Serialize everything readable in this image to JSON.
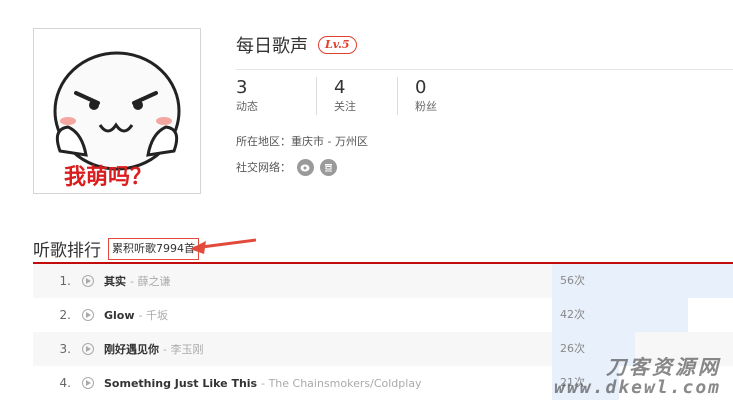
{
  "profile": {
    "name": "每日歌声",
    "level": "Lv.5",
    "stats": [
      {
        "value": "3",
        "label": "动态"
      },
      {
        "value": "4",
        "label": "关注"
      },
      {
        "value": "0",
        "label": "粉丝"
      }
    ],
    "location_label": "所在地区：",
    "location_value": "重庆市 - 万州区",
    "social_label": "社交网络：",
    "avatar_caption": "我萌吗？"
  },
  "ranking": {
    "title": "听歌排行",
    "total": "累积听歌7994首",
    "rows": [
      {
        "rank": "1.",
        "song": "其实",
        "artist": "- 薛之谦",
        "count": "56次",
        "fill": 1.0
      },
      {
        "rank": "2.",
        "song": "Glow",
        "artist": "- 千坂",
        "count": "42次",
        "fill": 0.75
      },
      {
        "rank": "3.",
        "song": "刚好遇见你",
        "artist": "- 李玉刚",
        "count": "26次",
        "fill": 0.46
      },
      {
        "rank": "4.",
        "song": "Something Just Like This",
        "artist": "- The Chainsmokers/Coldplay",
        "count": "21次",
        "fill": 0.37
      }
    ]
  },
  "watermark": {
    "cn": "刀客资源网",
    "url": "www.dkewl.com"
  },
  "colors": {
    "accent": "#c20c0c",
    "level": "#e0402f",
    "bar": "#e8f0fb"
  }
}
